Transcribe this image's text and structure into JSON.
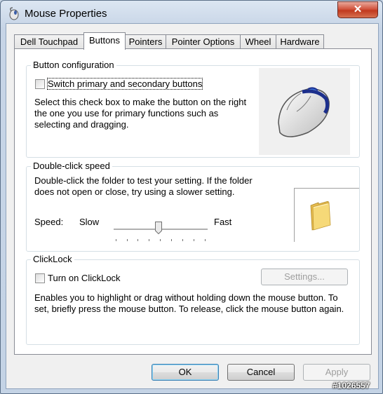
{
  "window": {
    "title": "Mouse Properties",
    "close_label": "✕"
  },
  "tabs": [
    {
      "label": "Dell Touchpad",
      "active": false
    },
    {
      "label": "Buttons",
      "active": true
    },
    {
      "label": "Pointers",
      "active": false
    },
    {
      "label": "Pointer Options",
      "active": false
    },
    {
      "label": "Wheel",
      "active": false
    },
    {
      "label": "Hardware",
      "active": false
    }
  ],
  "button_config": {
    "title": "Button configuration",
    "checkbox_label": "Switch primary and secondary buttons",
    "checked": false,
    "description": "Select this check box to make the button on the right the one you use for primary functions such as selecting and dragging."
  },
  "double_click": {
    "title": "Double-click speed",
    "description": "Double-click the folder to test your setting. If the folder does not open or close, try using a slower setting.",
    "speed_label": "Speed:",
    "slow_label": "Slow",
    "fast_label": "Fast",
    "speed_value": 0.5
  },
  "clicklock": {
    "title": "ClickLock",
    "checkbox_label": "Turn on ClickLock",
    "checked": false,
    "settings_label": "Settings...",
    "description": "Enables you to highlight or drag without holding down the mouse button. To set, briefly press the mouse button. To release, click the mouse button again."
  },
  "footer": {
    "ok": "OK",
    "cancel": "Cancel",
    "apply": "Apply"
  },
  "watermark": "#1026557"
}
